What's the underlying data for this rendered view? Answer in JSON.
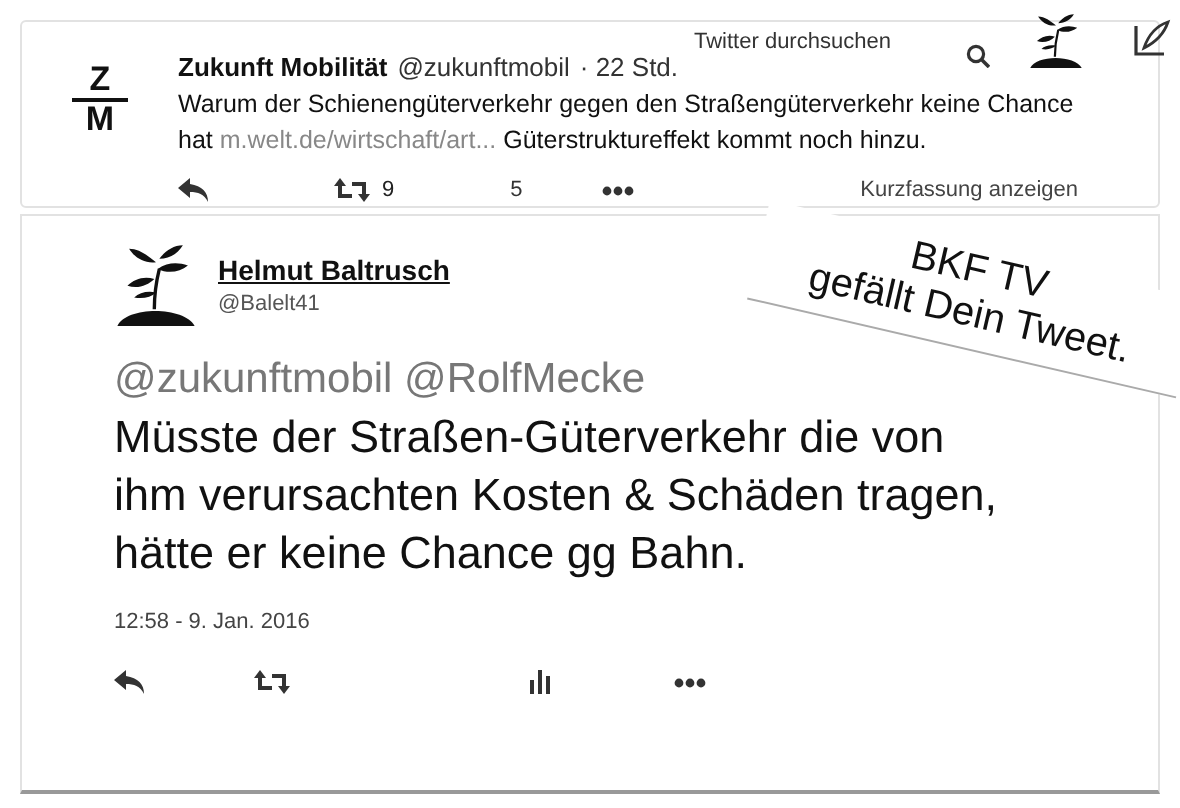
{
  "header": {
    "search": {
      "placeholder": "Twitter durchsuchen"
    }
  },
  "top_tweet": {
    "name": "Zukunft Mobilität",
    "handle": "@zukunftmobil",
    "time": "· 22 Std.",
    "avatar_letters": [
      "Z",
      "M"
    ],
    "text_before": "Warum der Schienengüterverkehr gegen den Straßengüterverkehr keine Chance hat",
    "link": "m.welt.de/wirtschaft/art...",
    "text_after": "Güterstruktureffekt kommt noch hinzu.",
    "retweets": "9",
    "likes": "5",
    "summary": "Kurzfassung anzeigen"
  },
  "main_tweet": {
    "name": "Helmut Baltrusch",
    "handle": "@Balelt41",
    "mentions": "@zukunftmobil @RolfMecke",
    "text": "Müsste der Straßen-Güterverkehr die von ihm verursachten Kosten & Schäden tragen, hätte er keine Chance gg Bahn.",
    "timestamp": "12:58 - 9. Jan. 2016"
  },
  "note": {
    "lines": [
      "BKF TV",
      "gefällt Dein Tweet."
    ]
  }
}
